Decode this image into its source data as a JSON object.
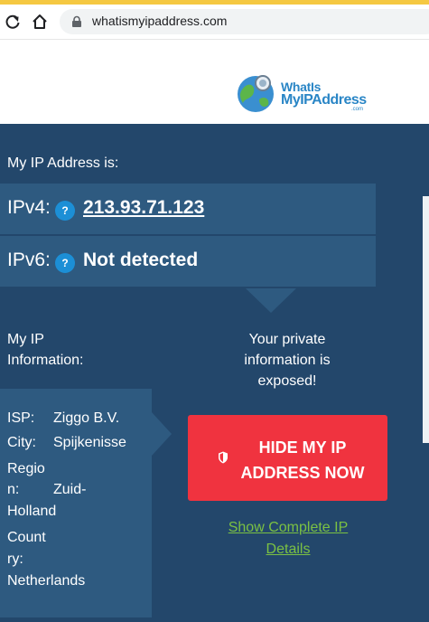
{
  "browser": {
    "url": "whatismyipaddress.com"
  },
  "logo": {
    "line1": "WhatIs",
    "line2": "MyIPAddress",
    "line3": ".com"
  },
  "ip_section": {
    "title": "My IP Address is:",
    "ipv4_label": "IPv4:",
    "ipv4_value": "213.93.71.123",
    "ipv6_label": "IPv6:",
    "ipv6_value": "Not detected",
    "help_glyph": "?"
  },
  "info_section": {
    "title": "My IP Information:",
    "isp_label": "ISP:",
    "isp_value": "Ziggo B.V.",
    "city_label": "City:",
    "city_value": "Spijkenisse",
    "region_label_1": "Regio",
    "region_label_2": "n:",
    "region_value_1": "Zuid-",
    "region_value_2": "Holland",
    "country_label_1": "Count",
    "country_label_2": "ry:",
    "country_value": "Netherlands"
  },
  "warning": {
    "text": "Your private information is exposed!",
    "button_label": "HIDE MY IP ADDRESS NOW",
    "details_link": "Show Complete IP Details"
  },
  "colors": {
    "panel": "#23476b",
    "row": "#2e5a80",
    "button": "#f0333f",
    "link": "#7bc143",
    "badge": "#1c8fd6"
  },
  "icons": [
    "reload-icon",
    "home-icon",
    "lock-icon",
    "globe-logo-icon",
    "help-icon",
    "shield-icon"
  ]
}
